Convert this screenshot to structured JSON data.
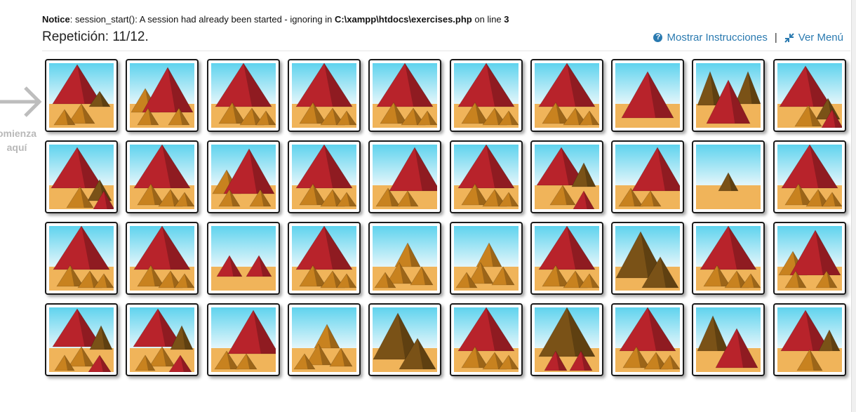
{
  "notice": {
    "label": "Notice",
    "message": ": session_start(): A session had already been started - ignoring in ",
    "path": "C:\\xampp\\htdocs\\exercises.php",
    "online": " on line ",
    "line": "3"
  },
  "title": "Repetición: 11/12.",
  "links": {
    "instructions": "Mostrar Instrucciones",
    "separator": "|",
    "menu": "Ver Menú"
  },
  "start_hint": [
    "omienza",
    "aquí"
  ],
  "icons": {
    "start": "arrow-right-icon",
    "instructions": "question-circle-icon",
    "menu": "compress-arrows-icon"
  },
  "colors": {
    "sky_top": "#5fd3ee",
    "sky_bottom": "#e8f7fb",
    "sand": "#f0b45a",
    "red_pyramid": "#b8232b",
    "gold_pyramid": "#c8821f",
    "dark_pyramid": "#7a5217",
    "link": "#2a7ab0"
  },
  "grid": {
    "rows": 4,
    "cols": 10,
    "tiles": [
      "big-red-left+small-gold",
      "gold-left+big-red",
      "big-red+small-gold",
      "big-red+small-gold",
      "big-red+small-gold",
      "big-red+small-gold",
      "big-red+small-gold",
      "single-red",
      "dark-two+red",
      "big-red+small-gold-red",
      "big-red+small-gold-red",
      "big-red+small-gold",
      "gold-left+big-red",
      "big-red+small-gold",
      "big-red-right+gold",
      "big-red+small-gold",
      "big-red+dark+red",
      "big-red-right+gold",
      "single-small-dark",
      "big-red+small-gold",
      "big-red+small-gold",
      "big-red+small-gold",
      "two-small-red",
      "big-red+small-gold",
      "gold-small-group",
      "gold-small-group",
      "big-red+small-gold",
      "big-dark-gold",
      "big-red+small-gold",
      "gold-left+big-red",
      "big-red+dark+small-gold-red",
      "big-red+dark+small-gold-red",
      "big-red-right+gold",
      "gold-small-group",
      "big-dark-gold",
      "big-red+small-gold",
      "big-dark+small-red",
      "big-red+small-gold",
      "dark-left+big-red",
      "big-red+dark+gold"
    ]
  }
}
